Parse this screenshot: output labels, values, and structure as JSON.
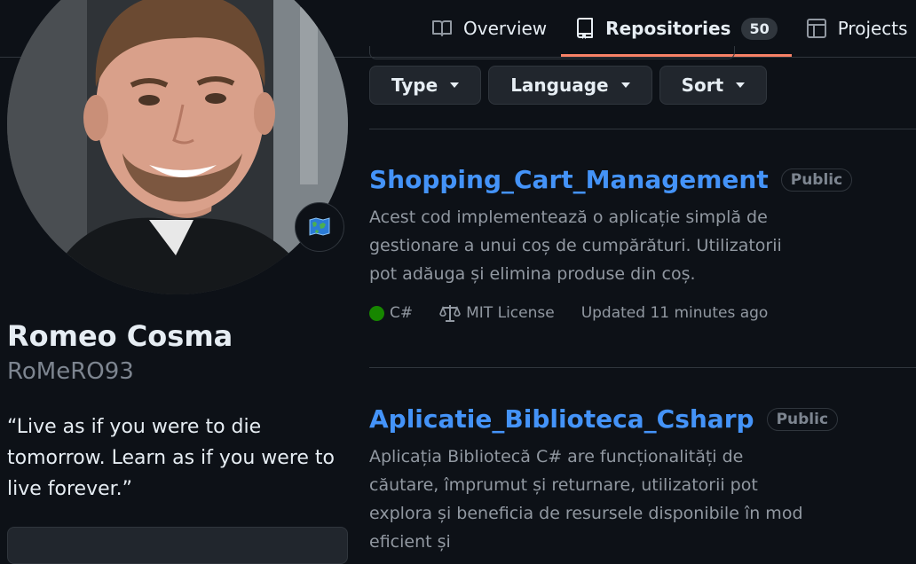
{
  "nav": {
    "overview_label": "Overview",
    "repositories_label": "Repositories",
    "repositories_count": "50",
    "projects_label": "Projects"
  },
  "profile": {
    "name": "Romeo Cosma",
    "login": "RoMeRO93",
    "bio": "“Live as if you were to die tomorrow. Learn as if you were to live forever.”"
  },
  "filters": {
    "type_label": "Type",
    "language_label": "Language",
    "sort_label": "Sort"
  },
  "repos": [
    {
      "name": "Shopping_Cart_Management",
      "visibility": "Public",
      "description": "Acest cod implementează o aplicație simplă de gestionare a unui coș de cumpărături. Utilizatorii pot adăuga și elimina produse din coș.",
      "language": "C#",
      "language_color": "#178600",
      "license": "MIT License",
      "updated": "Updated 11 minutes ago"
    },
    {
      "name": "Aplicatie_Biblioteca_Csharp",
      "visibility": "Public",
      "description": "Aplicația Bibliotecă C# are funcționalități de căutare, împrumut și returnare, utilizatorii pot explora și beneficia de resursele disponibile în mod eficient și"
    }
  ],
  "colors": {
    "accent": "#4493f8",
    "underline": "#f78166",
    "background": "#0d1117"
  },
  "icons": {
    "overview": "book-icon",
    "repositories": "repo-icon",
    "projects": "table-icon",
    "status": "world-map-icon",
    "license": "law-scale-icon"
  }
}
